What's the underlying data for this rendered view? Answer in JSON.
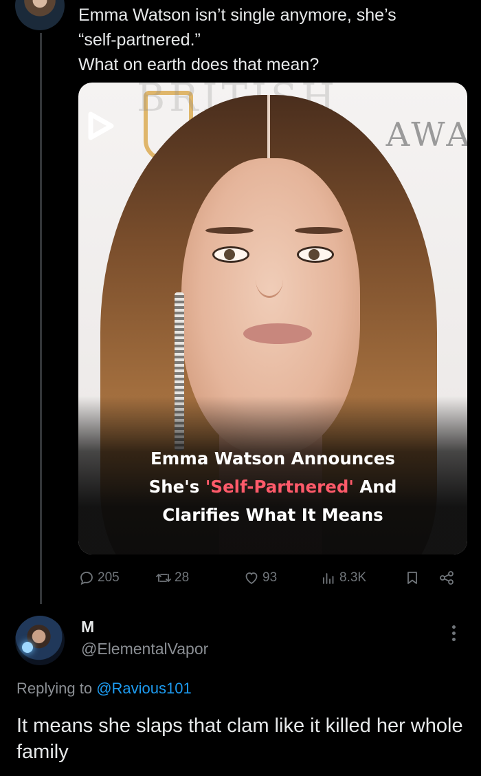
{
  "tweet": {
    "text_lines": [
      "Emma Watson isn’t single anymore, she’s",
      "“self-partnered.”",
      "What on earth does that mean?"
    ],
    "media": {
      "banner_text": "BRITISH",
      "banner_partial": "AWA",
      "headline_line1": "Emma Watson Announces",
      "headline_pre": "She's ",
      "headline_highlight": "'Self-Partnered'",
      "headline_post": " And",
      "headline_line3": "Clarifies What It Means",
      "highlight_color": "#ff5a6a"
    },
    "actions": {
      "replies": "205",
      "reposts": "28",
      "likes": "93",
      "views": "8.3K"
    }
  },
  "reply": {
    "name": "M",
    "handle": "@ElementalVapor",
    "replying_prefix": "Replying to ",
    "replying_to": "@Ravious101",
    "text": "It means she slaps that clam like it killed her whole family"
  },
  "colors": {
    "background": "#000000",
    "text": "#e7e9ea",
    "muted": "#71767b",
    "link": "#1d9bf0"
  }
}
